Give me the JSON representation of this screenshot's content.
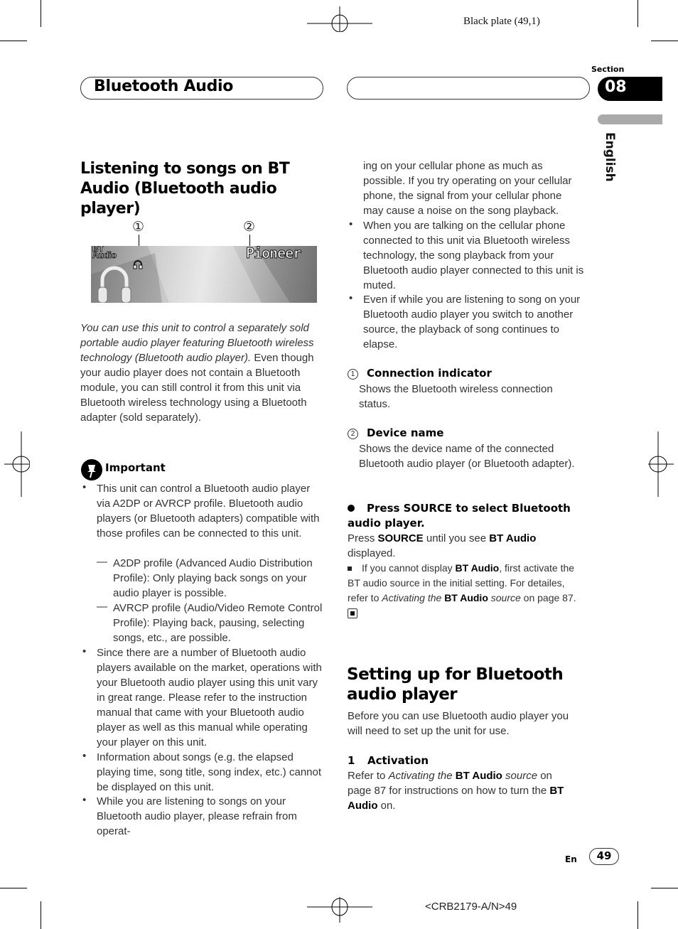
{
  "header": {
    "plate": "Black plate (49,1)",
    "title": "Bluetooth Audio",
    "section_label": "Section",
    "section_number": "08",
    "language": "English"
  },
  "left": {
    "heading": "Listening to songs on BT Audio (Bluetooth audio player)",
    "callouts": [
      "①",
      "②"
    ],
    "display": {
      "line1": "BT",
      "line2": "Audio",
      "device_name": "Pioneer",
      "icon": "headphones-icon"
    },
    "intro_italic": "You can use this unit to control a separately sold portable audio player featuring Bluetooth wireless technology (Bluetooth audio player).",
    "intro_rest": "Even though your audio player does not contain a Bluetooth module, you can still control it from this unit via Bluetooth wireless technology using a Bluetooth adapter (sold separately).",
    "important_label": "Important",
    "bullets": [
      "This unit can control a Bluetooth audio player via A2DP or AVRCP profile. Bluetooth audio players (or Bluetooth adapters) compatible with those profiles can be connected to this unit.",
      "Since there are a number of Bluetooth audio players available on the market, operations with your Bluetooth audio player using this unit vary in great range. Please refer to the instruction manual that came with your Bluetooth audio player as well as this manual while operating your player on this unit.",
      "Information about songs (e.g. the elapsed playing time, song title, song index, etc.) cannot be displayed on this unit.",
      "While you are listening to songs on your Bluetooth audio player, please refrain from operat-"
    ],
    "sub_bullets": [
      "A2DP profile (Advanced Audio Distribution Profile): Only playing back songs on your audio player is possible.",
      "AVRCP profile (Audio/Video Remote Control Profile): Playing back, pausing, selecting songs, etc., are possible."
    ]
  },
  "right": {
    "continuation": "ing on your cellular phone as much as possible. If you try operating on your cellular phone, the signal from your cellular phone may cause a noise on the song playback.",
    "bullets": [
      "When you are talking on the cellular phone connected to this unit via Bluetooth wireless technology, the song playback from your Bluetooth audio player connected to this unit is muted.",
      "Even if while you are listening to song on your Bluetooth audio player you switch to another source, the playback of song continues to elapse."
    ],
    "legend": [
      {
        "num": "1",
        "title": "Connection indicator",
        "desc": "Shows the Bluetooth wireless connection status."
      },
      {
        "num": "2",
        "title": "Device name",
        "desc": "Shows the device name of the connected Bluetooth audio player (or Bluetooth adapter)."
      }
    ],
    "step_head": "Press SOURCE to select Bluetooth audio player.",
    "step_body_1": "Press ",
    "step_body_source": "SOURCE",
    "step_body_2": " until you see ",
    "step_body_bt": "BT Audio",
    "step_body_3": " displayed.",
    "note_1": "If you cannot display ",
    "note_bt": "BT Audio",
    "note_2": ", first activate the BT audio source in the initial setting. For detailes, refer to ",
    "note_italic_1": "Activating the ",
    "note_bt2": "BT Audio",
    "note_italic_2": " source",
    "note_3": " on page 87.",
    "setup_heading": "Setting up for Bluetooth audio player",
    "setup_intro": "Before you can use Bluetooth audio player you will need to set up the unit for use.",
    "activation_num": "1",
    "activation_title": "Activation",
    "act_1": "Refer to ",
    "act_italic_1": "Activating the ",
    "act_bt": "BT Audio",
    "act_italic_2": " source",
    "act_2": " on page 87 for instructions on how to turn the ",
    "act_bt2": "BT Audio",
    "act_3": " on."
  },
  "footer": {
    "lang": "En",
    "page": "49",
    "code": "<CRB2179-A/N>49"
  }
}
